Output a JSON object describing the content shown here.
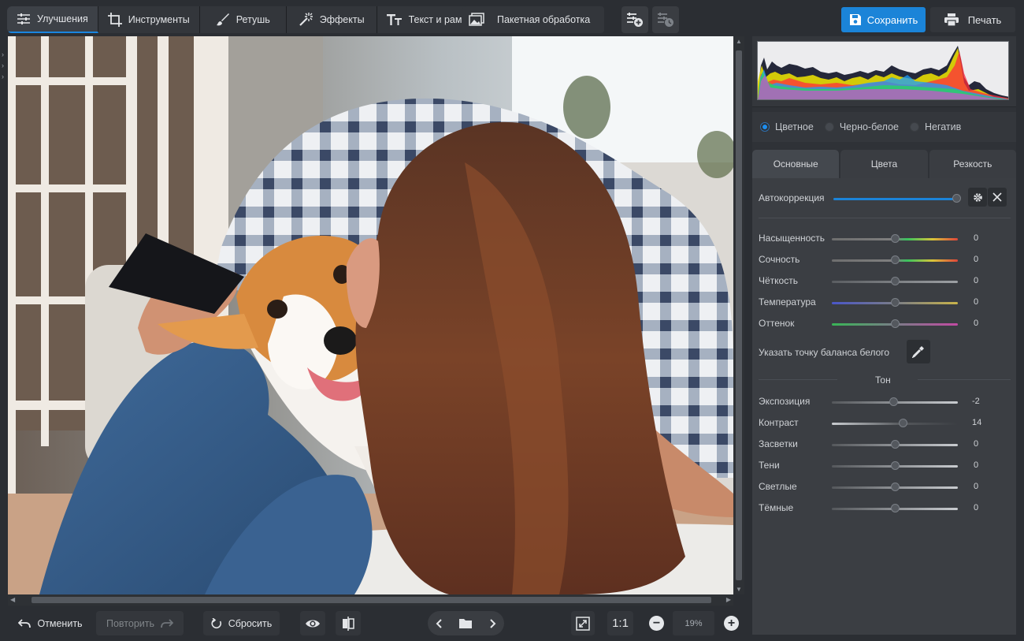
{
  "toolbar": {
    "tabs": [
      {
        "label": "Улучшения",
        "icon": "sliders-icon",
        "active": true
      },
      {
        "label": "Инструменты",
        "icon": "crop-icon",
        "active": false
      },
      {
        "label": "Ретушь",
        "icon": "brush-icon",
        "active": false
      },
      {
        "label": "Эффекты",
        "icon": "magic-wand-icon",
        "active": false
      },
      {
        "label": "Текст и рамки",
        "icon": "text-icon",
        "active": false
      }
    ],
    "batch_label": "Пакетная обработка",
    "save_label": "Сохранить",
    "print_label": "Печать",
    "accent_color": "#1b84d8"
  },
  "panel": {
    "color_modes": [
      {
        "label": "Цветное",
        "selected": true
      },
      {
        "label": "Черно-белое",
        "selected": false
      },
      {
        "label": "Негатив",
        "selected": false
      }
    ],
    "subtabs": [
      {
        "label": "Основные",
        "active": true
      },
      {
        "label": "Цвета",
        "active": false
      },
      {
        "label": "Резкость",
        "active": false
      }
    ],
    "autocorrection_label": "Автокоррекция",
    "basic_sliders": [
      {
        "label": "Насыщенность",
        "value": "0"
      },
      {
        "label": "Сочность",
        "value": "0"
      },
      {
        "label": "Чёткость",
        "value": "0"
      },
      {
        "label": "Температура",
        "value": "0"
      },
      {
        "label": "Оттенок",
        "value": "0"
      }
    ],
    "white_balance_label": "Указать точку баланса белого",
    "tone_header": "Тон",
    "tone_sliders": [
      {
        "label": "Экспозиция",
        "value": "-2"
      },
      {
        "label": "Контраст",
        "value": "14"
      },
      {
        "label": "Засветки",
        "value": "0"
      },
      {
        "label": "Тени",
        "value": "0"
      },
      {
        "label": "Светлые",
        "value": "0"
      },
      {
        "label": "Тёмные",
        "value": "0"
      }
    ]
  },
  "bottombar": {
    "undo_label": "Отменить",
    "redo_label": "Повторить",
    "reset_label": "Сбросить",
    "actual_size_label": "1:1",
    "zoom_value": "19%"
  }
}
